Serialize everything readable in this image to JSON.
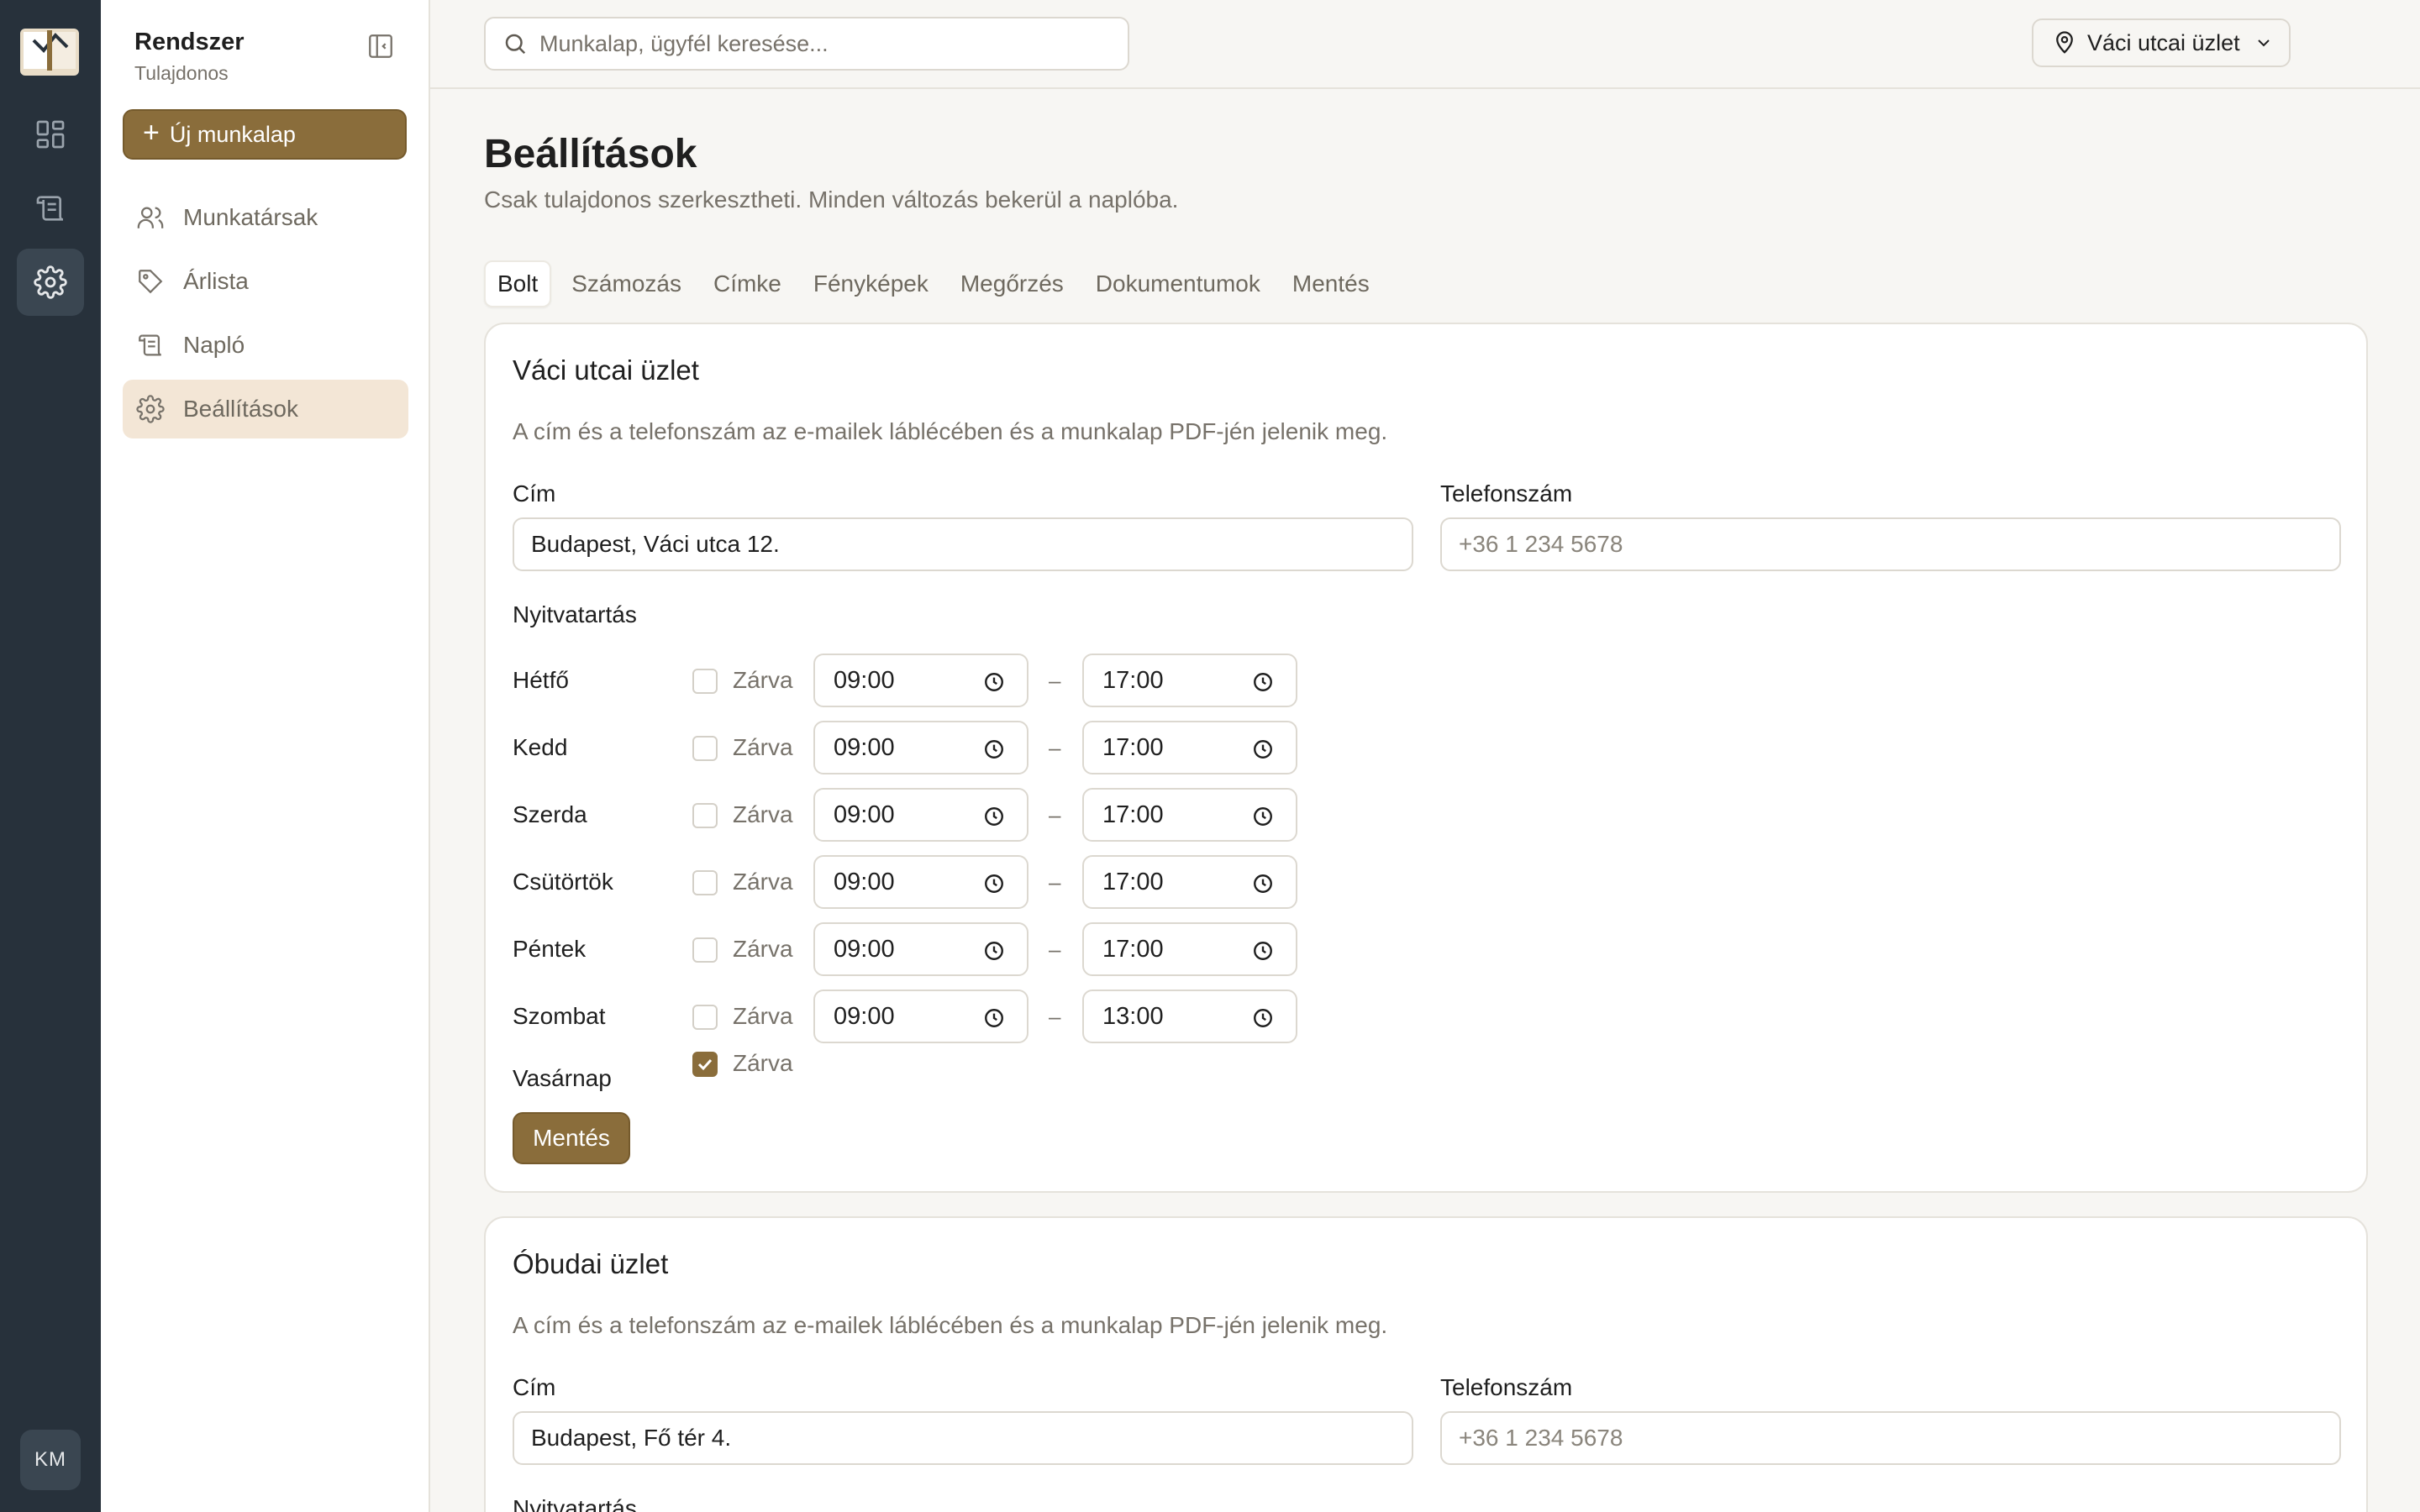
{
  "rail": {
    "avatar": "KM",
    "icons": [
      "book-logo-icon",
      "dashboard-icon",
      "worksheet-icon",
      "gear-icon"
    ]
  },
  "sidebar": {
    "title": "Rendszer",
    "subtitle": "Tulajdonos",
    "new_button": "Új munkalap",
    "items": [
      {
        "label": "Munkatársak",
        "icon": "users-icon"
      },
      {
        "label": "Árlista",
        "icon": "tag-icon"
      },
      {
        "label": "Napló",
        "icon": "scroll-icon"
      },
      {
        "label": "Beállítások",
        "icon": "gear-icon",
        "active": true
      }
    ]
  },
  "topbar": {
    "search_placeholder": "Munkalap, ügyfél keresése...",
    "store": "Váci utcai üzlet"
  },
  "page": {
    "title": "Beállítások",
    "subtitle": "Csak tulajdonos szerkesztheti. Minden változás bekerül a naplóba."
  },
  "tabs": [
    {
      "label": "Bolt",
      "active": true
    },
    {
      "label": "Számozás"
    },
    {
      "label": "Címke"
    },
    {
      "label": "Fényképek"
    },
    {
      "label": "Megőrzés"
    },
    {
      "label": "Dokumentumok"
    },
    {
      "label": "Mentés"
    }
  ],
  "stores": [
    {
      "name": "Váci utcai üzlet",
      "description": "A cím és a telefonszám az e-mailek láblécében és a munkalap PDF-jén jelenik meg.",
      "address_label": "Cím",
      "address": "Budapest, Váci utca 12.",
      "phone_label": "Telefonszám",
      "phone_placeholder": "+36 1 234 5678",
      "hours_label": "Nyitvatartás",
      "closed_label": "Zárva",
      "dash": "–",
      "save": "Mentés",
      "hours": [
        {
          "day": "Hétfő",
          "closed": false,
          "open": "09:00",
          "close": "17:00"
        },
        {
          "day": "Kedd",
          "closed": false,
          "open": "09:00",
          "close": "17:00"
        },
        {
          "day": "Szerda",
          "closed": false,
          "open": "09:00",
          "close": "17:00"
        },
        {
          "day": "Csütörtök",
          "closed": false,
          "open": "09:00",
          "close": "17:00"
        },
        {
          "day": "Péntek",
          "closed": false,
          "open": "09:00",
          "close": "17:00"
        },
        {
          "day": "Szombat",
          "closed": false,
          "open": "09:00",
          "close": "13:00"
        },
        {
          "day": "Vasárnap",
          "closed": true
        }
      ]
    },
    {
      "name": "Óbudai üzlet",
      "description": "A cím és a telefonszám az e-mailek láblécében és a munkalap PDF-jén jelenik meg.",
      "address_label": "Cím",
      "address": "Budapest, Fő tér 4.",
      "phone_label": "Telefonszám",
      "phone_placeholder": "+36 1 234 5678",
      "hours_label": "Nyitvatartás"
    }
  ],
  "colors": {
    "rail": "#27313b",
    "accent": "#8a6d3b",
    "active_nav": "#f3e6d6",
    "background": "#f7f6f3"
  }
}
